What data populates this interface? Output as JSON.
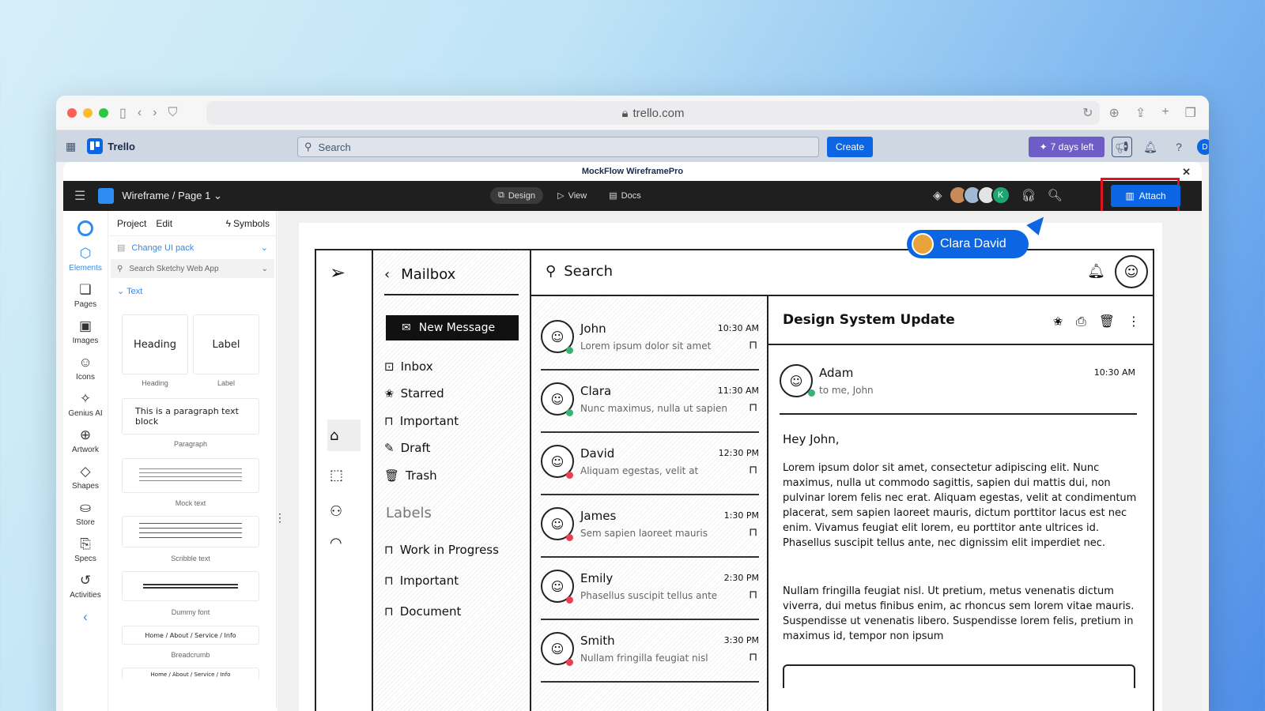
{
  "browser": {
    "url": "trello.com"
  },
  "trello": {
    "app_name": "Trello",
    "search_placeholder": "Search",
    "create_label": "Create",
    "trial_label": "7 days left",
    "avatar_initial": "D"
  },
  "modal": {
    "title": "MockFlow WireframePro"
  },
  "mockflow": {
    "breadcrumb": "Wireframe / Page 1",
    "tabs": [
      {
        "label": "Design"
      },
      {
        "label": "View"
      },
      {
        "label": "Docs"
      }
    ],
    "collab_initial": "K",
    "attach_label": "Attach"
  },
  "rail": {
    "items": [
      {
        "label": "Elements"
      },
      {
        "label": "Pages"
      },
      {
        "label": "Images"
      },
      {
        "label": "Icons"
      },
      {
        "label": "Genius AI"
      },
      {
        "label": "Artwork"
      },
      {
        "label": "Shapes"
      },
      {
        "label": "Store"
      },
      {
        "label": "Specs"
      },
      {
        "label": "Activities"
      }
    ]
  },
  "panel": {
    "tab_project": "Project",
    "tab_edit": "Edit",
    "tab_symbols": "Symbols",
    "change_pack": "Change UI pack",
    "search_placeholder": "Search Sketchy Web App",
    "section": "Text",
    "cards": {
      "heading": "Heading",
      "label": "Label",
      "paragraph": "This is a paragraph text block"
    },
    "captions": {
      "heading": "Heading",
      "label": "Label",
      "paragraph": "Paragraph",
      "mock": "Mock text",
      "scribble": "Scribble text",
      "dummy": "Dummy font",
      "breadcrumb": "Breadcrumb"
    },
    "breadcrumb_sample": "Home  /  About  /  Service  /  Info"
  },
  "wireframe": {
    "menu_title": "Mailbox",
    "new_message": "New Message",
    "menu": [
      "Inbox",
      "Starred",
      "Important",
      "Draft",
      "Trash"
    ],
    "labels_heading": "Labels",
    "labels": [
      "Work in Progress",
      "Important",
      "Document"
    ],
    "search": "Search",
    "mails": [
      {
        "name": "John",
        "time": "10:30 AM",
        "snippet": "Lorem ipsum dolor sit amet",
        "status": "#3bb273"
      },
      {
        "name": "Clara",
        "time": "11:30 AM",
        "snippet": "Nunc maximus, nulla ut sapien",
        "status": "#3bb273"
      },
      {
        "name": "David",
        "time": "12:30 PM",
        "snippet": "Aliquam egestas, velit at",
        "status": "#e8414d"
      },
      {
        "name": "James",
        "time": "1:30 PM",
        "snippet": "Sem sapien laoreet mauris",
        "status": "#e8414d"
      },
      {
        "name": "Emily",
        "time": "2:30 PM",
        "snippet": "Phasellus suscipit tellus ante",
        "status": "#e8414d"
      },
      {
        "name": "Smith",
        "time": "3:30 PM",
        "snippet": "Nullam fringilla feugiat nisl",
        "status": "#e8414d"
      }
    ],
    "detail": {
      "title": "Design System Update",
      "from": "Adam",
      "to": "to me, John",
      "time": "10:30 AM",
      "greeting": "Hey John,",
      "para1": "Lorem ipsum dolor sit amet, consectetur adipiscing elit. Nunc maximus, nulla ut commodo sagittis, sapien dui mattis dui, non pulvinar lorem felis nec erat. Aliquam egestas, velit at condimentum placerat, sem sapien laoreet mauris, dictum porttitor lacus est nec enim. Vivamus feugiat elit lorem, eu porttitor ante ultrices id. Phasellus suscipit tellus ante, nec dignissim elit imperdiet nec.",
      "para2": "Nullam fringilla feugiat nisl. Ut pretium, metus venenatis dictum viverra, dui metus finibus enim, ac rhoncus sem lorem vitae mauris. Suspendisse ut venenatis libero. Suspendisse lorem felis, pretium in maximus id, tempor non ipsum"
    }
  },
  "collaborator": {
    "name": "Clara David"
  },
  "colors": {
    "accent": "#0c66e4",
    "highlight": "#e0141e",
    "trial": "#6e5dc6"
  }
}
